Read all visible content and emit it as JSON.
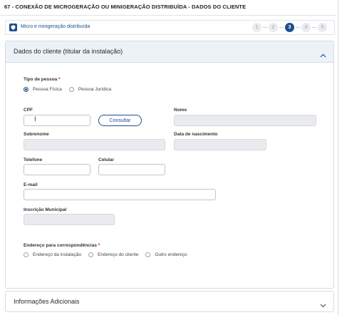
{
  "page": {
    "title": "67 - CONEXÃO DE MICROGERAÇÃO OU MINIGERAÇÃO DISTRIBUÍDA - DADOS DO CLIENTE"
  },
  "stepbar": {
    "service_label": "Micro e minigeração distribuída",
    "steps": [
      "1",
      "2",
      "3",
      "4",
      "5"
    ],
    "active_step": "3"
  },
  "panel": {
    "title": "Dados do cliente (titular da instalação)",
    "tipo_pessoa": {
      "label": "Tipo de pessoa",
      "required_mark": "*",
      "options": [
        "Pessoa Física",
        "Pessoa Jurídica"
      ],
      "selected": "Pessoa Física"
    },
    "cpf": {
      "label": "CPF",
      "value": ""
    },
    "consultar_label": "Consultar",
    "nome": {
      "label": "Nome",
      "value": ""
    },
    "sobrenome": {
      "label": "Sobrenome",
      "value": ""
    },
    "data_nascimento": {
      "label": "Data de nascimento",
      "value": ""
    },
    "telefone": {
      "label": "Telefone",
      "value": ""
    },
    "celular": {
      "label": "Celular",
      "value": ""
    },
    "email": {
      "label": "E-mail",
      "value": ""
    },
    "inscricao_municipal": {
      "label": "Inscrição Municipal",
      "value": ""
    },
    "endereco": {
      "label": "Endereço para correspondências",
      "required_mark": "*",
      "options": [
        "Endereço da instalação",
        "Endereço do cliente",
        "Outro endereço"
      ],
      "selected": ""
    }
  },
  "panel2": {
    "title": "Informações Adicionais"
  },
  "colors": {
    "accent": "#1d4f8f",
    "header_bg": "#edf2f9",
    "disabled_bg": "#e9ebee",
    "required": "#d0021b"
  },
  "icons": {
    "service": "shield-icon",
    "collapse": "chevron-up-icon",
    "expand": "chevron-down-icon",
    "cursor": "text-cursor-icon"
  }
}
